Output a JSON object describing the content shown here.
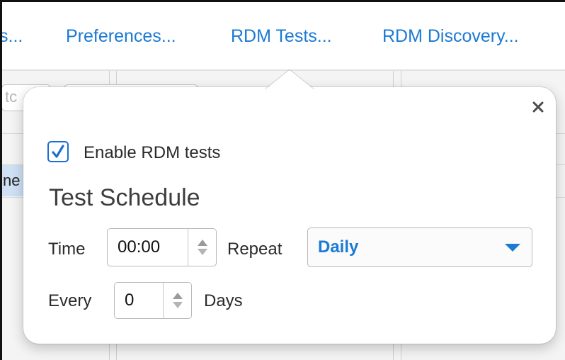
{
  "toolbar": {
    "items": [
      {
        "label": "s..."
      },
      {
        "label": "Preferences..."
      },
      {
        "label": "RDM Tests..."
      },
      {
        "label": "RDM Discovery..."
      }
    ]
  },
  "background": {
    "row_text": "ne",
    "field_text": "tc"
  },
  "popover": {
    "enable_checkbox": {
      "label": "Enable RDM tests",
      "checked": true
    },
    "section_title": "Test Schedule",
    "time": {
      "label": "Time",
      "value": "00:00"
    },
    "repeat": {
      "label": "Repeat",
      "value": "Daily"
    },
    "every": {
      "label": "Every",
      "value": "0",
      "unit": "Days"
    }
  },
  "colors": {
    "accent": "#1b7ad3",
    "checkbox_border": "#1b6fd1"
  },
  "icons": [
    "close-icon",
    "checkmark-icon",
    "stepper-up-icon",
    "stepper-down-icon",
    "dropdown-caret-icon"
  ]
}
